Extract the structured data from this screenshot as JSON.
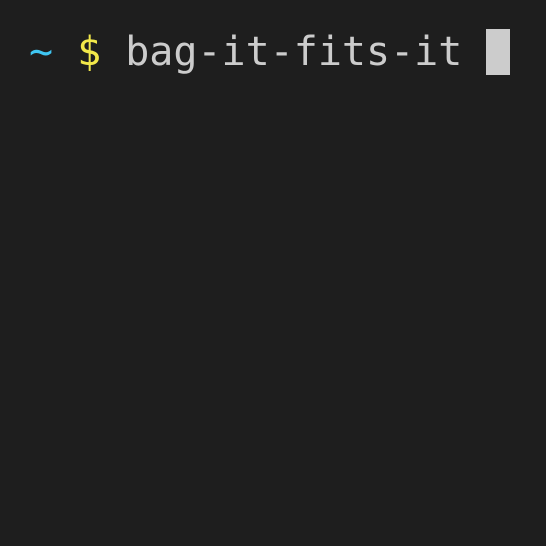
{
  "terminal": {
    "cwd_symbol": "~",
    "prompt_symbol": "$",
    "command": "bag-it-fits-it"
  },
  "colors": {
    "background": "#1e1e1e",
    "cwd": "#3fc6f2",
    "prompt": "#f2e84a",
    "text": "#cccccc",
    "cursor": "#cccccc"
  }
}
